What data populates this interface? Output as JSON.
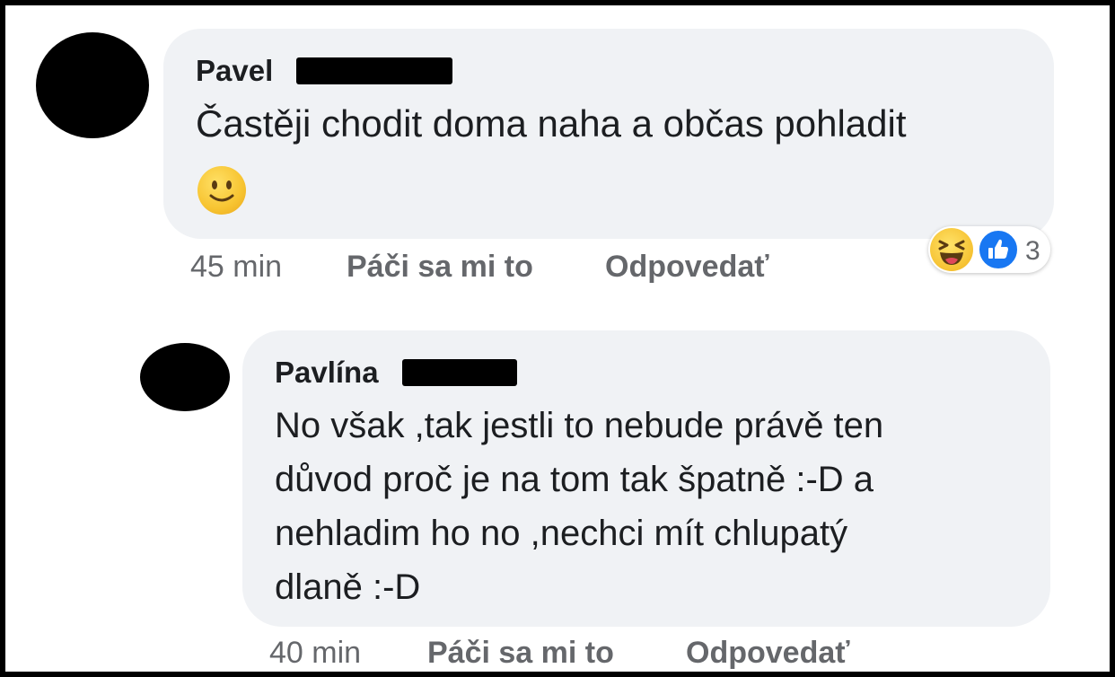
{
  "comments": [
    {
      "author": "Pavel",
      "text": "Častěji chodit doma naha a občas pohladit",
      "emoji": "slightly-smiling-face",
      "time": "45 min",
      "like_label": "Páči sa mi to",
      "reply_label": "Odpovedať",
      "reactions": {
        "types": [
          "haha",
          "like"
        ],
        "count": "3"
      }
    },
    {
      "author": "Pavlína",
      "text_lines": [
        "No však ,tak jestli to nebude právě ten",
        "důvod proč je na tom tak špatně :-D a",
        "nehladim ho no ,nechci mít chlupatý",
        "dlaně :-D"
      ],
      "time": "40 min",
      "like_label": "Páči sa mi to",
      "reply_label": "Odpovedať"
    }
  ],
  "colors": {
    "bubble_bg": "#f0f2f5",
    "text": "#1c1e21",
    "meta_text": "#65676b",
    "like_blue": "#1877f2",
    "redaction": "#000000"
  }
}
